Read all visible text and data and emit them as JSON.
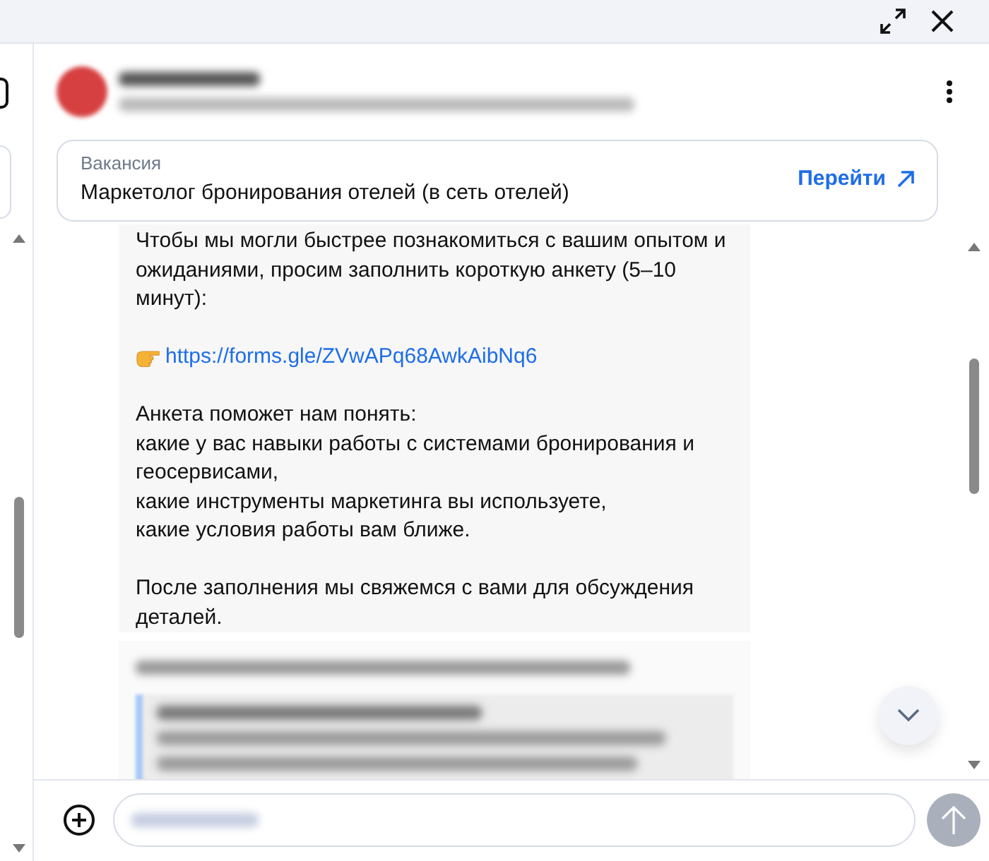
{
  "vacancy": {
    "label": "Вакансия",
    "title": "Маркетолог бронирования отелей (в сеть отелей)",
    "action": "Перейти"
  },
  "message": {
    "blocks": [
      {
        "kind": "text",
        "text": "Чтобы мы могли быстрее познакомиться с вашим опытом и ожиданиями, просим заполнить короткую анкету (5–10 минут):"
      },
      {
        "kind": "link",
        "text": "https://forms.gle/ZVwAPq68AwkAibNq6"
      },
      {
        "kind": "lines",
        "lines": [
          "Анкета поможет нам понять:",
          "какие у вас навыки работы с системами бронирования и геосервисами,",
          "какие инструменты маркетинга вы используете,",
          "какие условия работы вам ближе."
        ]
      },
      {
        "kind": "text",
        "text": "После заполнения мы свяжемся с вами для обсуждения деталей."
      }
    ]
  }
}
